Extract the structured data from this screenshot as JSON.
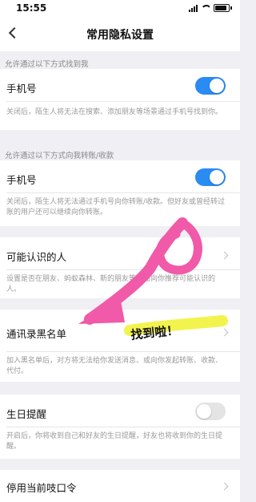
{
  "status_bar": {
    "time": "15:55"
  },
  "nav": {
    "title": "常用隐私设置"
  },
  "sections": {
    "find_me": {
      "header": "允许通过以下方式找到我",
      "phone": {
        "title": "手机号",
        "enabled": true,
        "desc": "关闭后，陌生人将无法在搜索、添加朋友等场景通过手机号找到你。"
      }
    },
    "transfer": {
      "header": "允许通过以下方式向我转账/收款",
      "phone": {
        "title": "手机号",
        "enabled": true,
        "desc": "关闭后，陌生人将无法通过手机号向你转账/收款。但好友或曾经转过账的用户还可以继续向你转账。"
      }
    },
    "people_you_may_know": {
      "title": "可能认识的人",
      "desc": "设置是否在朋友、蚂蚁森林、新的朋友等页面向你推荐可能认识的人。"
    },
    "blocklist": {
      "title": "通讯录黑名单",
      "desc": "加入黑名单后，对方将无法给你发送消息、或向你发起转账、收款、代付。"
    },
    "birthday": {
      "title": "生日提醒",
      "enabled": false,
      "desc": "开启后，你将收到自己和好友的生日提醒，好友也将收到你的生日提醒。"
    },
    "kouling": {
      "title": "停用当前吱口令"
    }
  },
  "annotation": {
    "text": "找到啦！",
    "colors": {
      "arrow": "#f05aa8",
      "highlight": "#f2f23a"
    }
  },
  "colors": {
    "toggle_on": "#2a8bf2",
    "toggle_off": "#e4e4e4",
    "background": "#efeff4"
  }
}
